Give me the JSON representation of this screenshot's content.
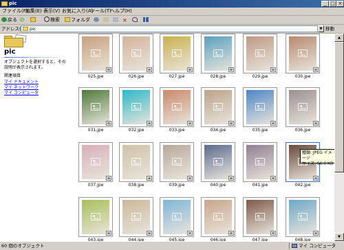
{
  "window": {
    "title": "pic"
  },
  "menu": [
    "ファイル(F)",
    "編集(E)",
    "表示(V)",
    "お気に入り(A)",
    "ツール(T)",
    "ヘルプ(H)"
  ],
  "toolbar": {
    "back": "戻る",
    "search": "検索",
    "folders": "フォルダ"
  },
  "address": {
    "label": "アドレス(D)",
    "value": "pic",
    "go": "移動"
  },
  "left_pane": {
    "title": "pic",
    "description": "オブジェクトを選択すると、その説明が表示されます。",
    "related_heading": "関連項目",
    "links": [
      "マイ ドキュメント",
      "マイ ネットワーク",
      "マイ コンピュータ"
    ]
  },
  "files": [
    {
      "name": "025.jpe",
      "c": "#c8a07c"
    },
    {
      "name": "026.jpe",
      "c": "#d2b49a"
    },
    {
      "name": "027.jpe",
      "c": "#c9b14e"
    },
    {
      "name": "028.jpe",
      "c": "#5aa0be"
    },
    {
      "name": "029.jpe",
      "c": "#bf9a84"
    },
    {
      "name": "030.jpe",
      "c": "#b88a6e"
    },
    {
      "name": "031.jpe",
      "c": "#4f7a3a"
    },
    {
      "name": "032.jpe",
      "c": "#2fb8c8"
    },
    {
      "name": "033.jpe",
      "c": "#c98a6a"
    },
    {
      "name": "034.jpe",
      "c": "#bca38a"
    },
    {
      "name": "035.jpe",
      "c": "#4f86c6"
    },
    {
      "name": "036.jpe",
      "c": "#9a9190"
    },
    {
      "name": "037.jpe",
      "c": "#d8b0b8"
    },
    {
      "name": "038.jpe",
      "c": "#cfc2a6"
    },
    {
      "name": "039.jpe",
      "c": "#b8a89a"
    },
    {
      "name": "040.jpe",
      "c": "#5b6b8f"
    },
    {
      "name": "041.jpe",
      "c": "#8f7f92"
    },
    {
      "name": "042.jpe",
      "c": "#6a4a3a"
    },
    {
      "name": "043.jpe",
      "c": "#a8c05a"
    },
    {
      "name": "044.jpe",
      "c": "#cbb89a"
    },
    {
      "name": "045.jpe",
      "c": "#7fb6d8"
    },
    {
      "name": "046.jpe",
      "c": "#c9a68c"
    },
    {
      "name": "047.jpe",
      "c": "#7e5a4a"
    },
    {
      "name": "048.jpe",
      "c": "#6fa8c8"
    }
  ],
  "tooltip": {
    "type": "種類: JPEG イメージ",
    "size": "サイズ: 66.6 KB"
  },
  "status": {
    "count": "60 個のオブジェクト",
    "zone": "マイ コンピュータ"
  }
}
